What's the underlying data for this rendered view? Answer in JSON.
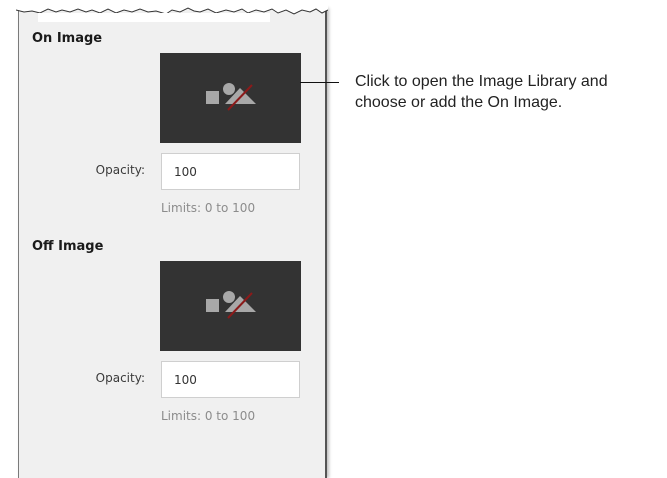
{
  "on_image": {
    "title": "On Image",
    "picker_icon": "image-placeholder-icon",
    "opacity_label": "Opacity:",
    "opacity_value": "100",
    "limits": "Limits: 0 to 100"
  },
  "off_image": {
    "title": "Off Image",
    "picker_icon": "image-placeholder-icon",
    "opacity_label": "Opacity:",
    "opacity_value": "100",
    "limits": "Limits: 0 to 100"
  },
  "callout": {
    "line1": "Click to open the Image Library and",
    "line2": "choose or add the On Image."
  },
  "colors": {
    "panel_bg": "#f0f0f0",
    "picker_bg": "#333333",
    "icon_gray": "#a8a8a8",
    "slash_red": "#8b1a1a"
  }
}
